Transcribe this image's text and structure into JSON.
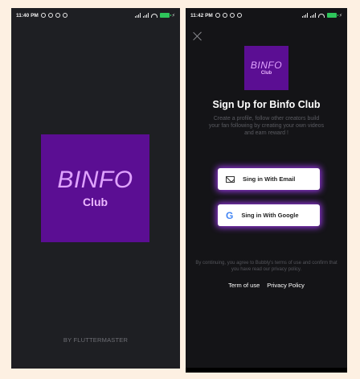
{
  "left": {
    "status": {
      "time": "11:40 PM"
    },
    "logo": {
      "title": "BINFO",
      "subtitle": "Club"
    },
    "credit": "BY FLUTTERMASTER"
  },
  "right": {
    "status": {
      "time": "11:42 PM"
    },
    "logo": {
      "title": "BINFO",
      "subtitle": "Club"
    },
    "heading": "Sign Up for Binfo Club",
    "description": "Create a profile, follow other creators build your fan following by creating your own videos and earn reward !",
    "buttons": {
      "email": {
        "label": "Sing in With Email",
        "icon": "mail-icon"
      },
      "google": {
        "label": "Sing in With Google",
        "icon": "google-icon"
      }
    },
    "legal": "By continuing, you agree to  Bubbly's terms of use and confirm that you have read our privacy policy.",
    "links": {
      "terms": "Term of use",
      "privacy": "Privacy Policy"
    }
  },
  "colors": {
    "background": "#fdf0e2",
    "screen": "#1e1f23",
    "brand_purple": "#5b0e93",
    "logo_text": "#e0a3ff",
    "button_glow": "#a83cff",
    "battery": "#2ec65b"
  }
}
